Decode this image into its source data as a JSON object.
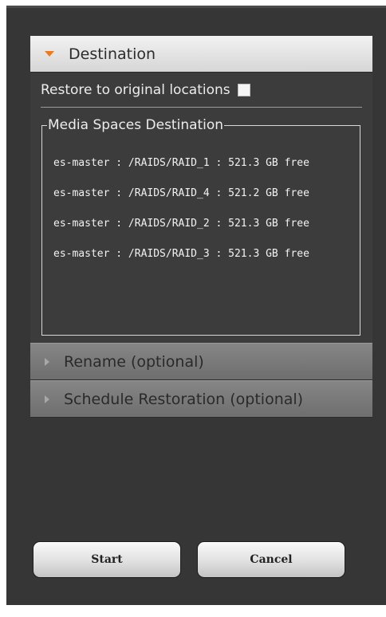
{
  "destination": {
    "header": "Destination",
    "restore_label": "Restore to original locations",
    "restore_checked": false,
    "legend": "Media Spaces Destination",
    "media_spaces": [
      "es-master : /RAIDS/RAID_1 : 521.3 GB free",
      "es-master : /RAIDS/RAID_4 : 521.2 GB free",
      "es-master : /RAIDS/RAID_2 : 521.3 GB free",
      "es-master : /RAIDS/RAID_3 : 521.3 GB free"
    ]
  },
  "sections": {
    "rename": "Rename (optional)",
    "schedule": "Schedule Restoration (optional)"
  },
  "buttons": {
    "start": "Start",
    "cancel": "Cancel"
  },
  "colors": {
    "accent_arrow": "#f07a1a",
    "window_bg": "#363636"
  }
}
